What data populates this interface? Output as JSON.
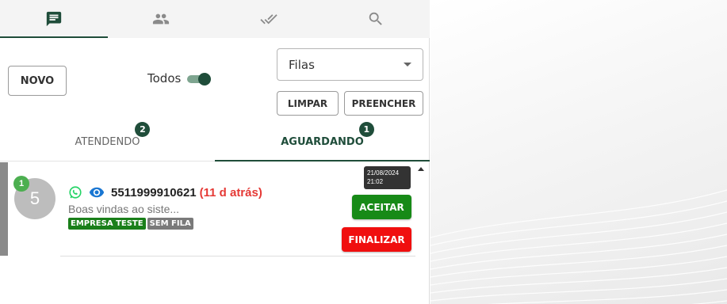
{
  "nav": {
    "tabs": [
      {
        "icon": "chat-icon",
        "active": true
      },
      {
        "icon": "contacts-icon",
        "active": false
      },
      {
        "icon": "done-all-icon",
        "active": false
      },
      {
        "icon": "search-icon",
        "active": false
      }
    ]
  },
  "controls": {
    "new_label": "NOVO",
    "todos_label": "Todos",
    "todos_on": true,
    "queue_select": "Filas",
    "clear_label": "LIMPAR",
    "fill_label": "PREENCHER"
  },
  "subtabs": [
    {
      "label": "ATENDENDO",
      "count": "2",
      "active": false
    },
    {
      "label": "AGUARDANDO",
      "count": "1",
      "active": true
    }
  ],
  "ticket": {
    "avatar_text": "5",
    "unread": "1",
    "number": "5511999910621",
    "ago": "(11 d atrás)",
    "preview": "Boas vindas ao siste...",
    "tags": [
      "EMPRESA TESTE",
      "SEM FILA"
    ],
    "date": "21/08/2024",
    "time": "21:02",
    "accept_label": "ACEITAR",
    "finish_label": "FINALIZAR"
  },
  "colors": {
    "primary": "#1f4d3a",
    "accept": "#178a17",
    "finish": "#f00f0f",
    "ago": "#e53935",
    "whatsapp": "#25d366",
    "eye": "#1976d2"
  }
}
